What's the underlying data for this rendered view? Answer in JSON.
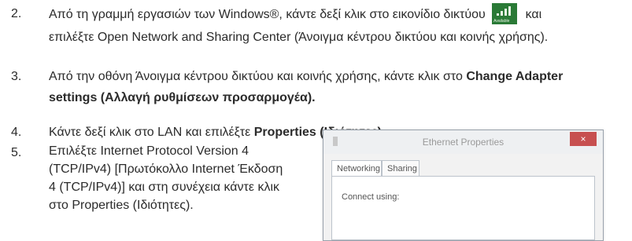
{
  "steps": [
    {
      "num": "2.",
      "line1_before_icon": "Από τη γραμμή εργασιών των Windows®, κάντε δεξί κλικ στο εικονίδιο δικτύου",
      "line1_after_icon": "και",
      "line2": "επιλέξτε Open Network and Sharing Center (Άνοιγμα κέντρου δικτύου και κοινής χρήσης)."
    },
    {
      "num": "3.",
      "line1_normal": "Από την οθόνη Άνοιγμα κέντρου δικτύου και κοινής χρήσης, κάντε κλικ στο ",
      "line1_bold": "Change Adapter",
      "line2_bold": "settings (Αλλαγή ρυθμίσεων προσαρμογέα)."
    },
    {
      "num": "4.",
      "normal": "Κάντε δεξί κλικ στο LAN και επιλέξτε ",
      "bold": "Properties (Ιδιότητες)."
    },
    {
      "num": "5.",
      "lines": [
        "Επιλέξτε Internet Protocol Version 4",
        "(TCP/IPv4) [Πρωτόκολλο Internet Έκδοση",
        "4 (TCP/IPv4)] και στη συνέχεια κάντε κλικ",
        "στο Properties (Ιδιότητες)."
      ]
    }
  ],
  "network_icon": {
    "name": "network-signal-icon",
    "label": "Available",
    "color": "#2a7a36"
  },
  "dialog": {
    "title": "Ethernet Properties",
    "close": "×",
    "tabs": [
      "Networking",
      "Sharing"
    ],
    "connect_using": "Connect using:",
    "close_color": "#c75050"
  }
}
